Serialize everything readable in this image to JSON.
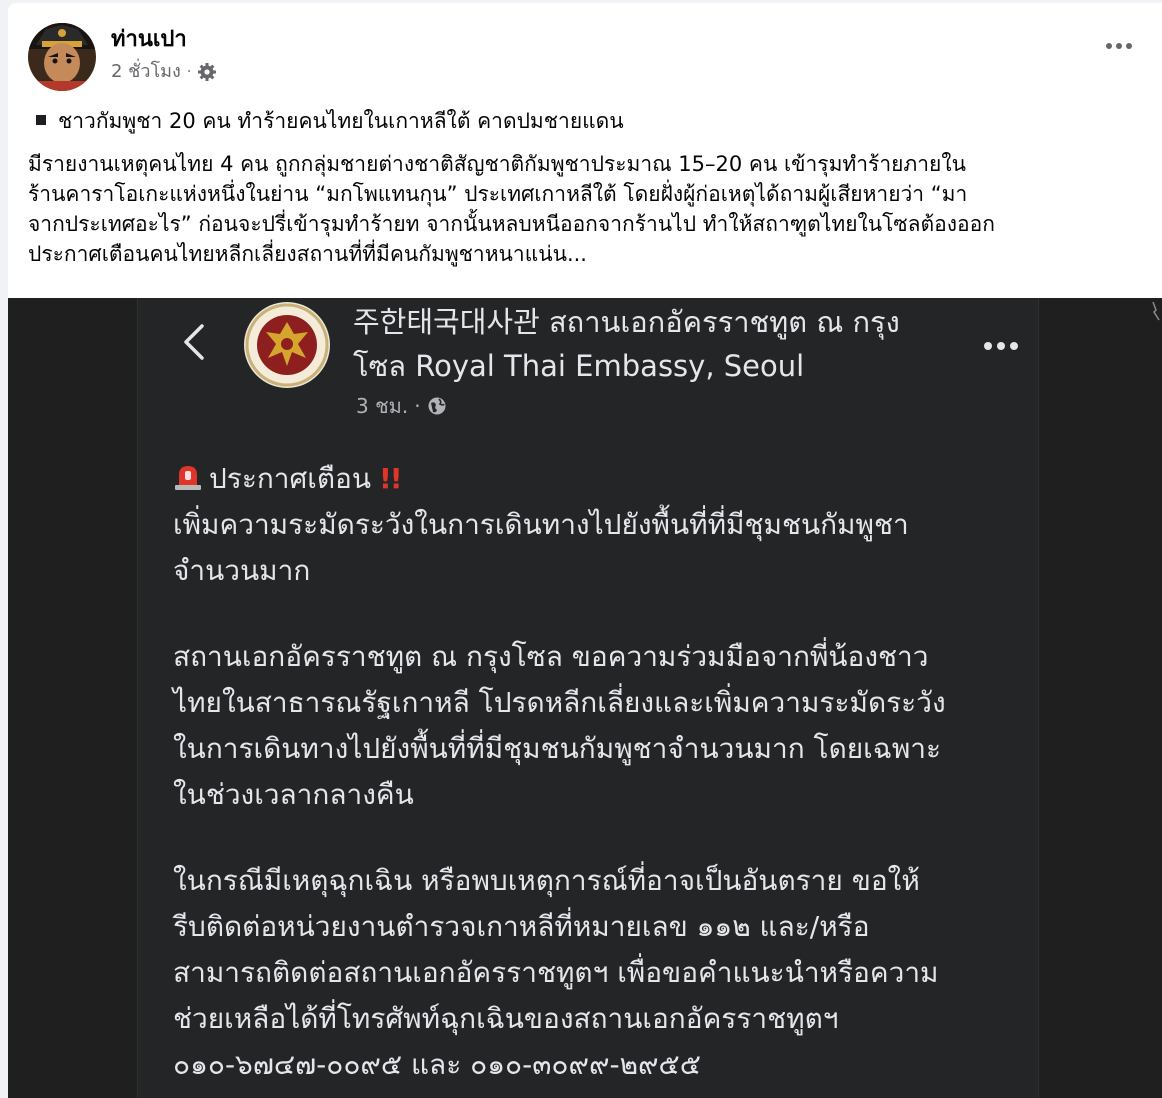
{
  "post": {
    "author": "ท่านเปา",
    "time": "2 ชั่วโมง",
    "separator": "·",
    "headline": "ชาวกัมพูชา 20 คน ทำร้ายคนไทยในเกาหลีใต้ คาดปมชายแดน",
    "body_lines": [
      "มีรายงานเหตุคนไทย 4 คน ถูกกลุ่มชายต่างชาติสัญชาติกัมพูชาประมาณ 15–20 คน เข้ารุมทำร้ายภายใน",
      "ร้านคาราโอเกะแห่งหนึ่งในย่าน “มกโพแทนกุน” ประเทศเกาหลีใต้ โดยฝั่งผู้ก่อเหตุได้ถามผู้เสียหายว่า “มา",
      "จากประเทศอะไร” ก่อนจะปรี่เข้ารุมทำร้ายท จากนั้นหลบหนีออกจากร้านไป ทำให้สถาฑูตไทยในโซลต้องออก",
      "ประกาศเตือนคนไทยหลีกเลี่ยงสถานที่ที่มีคนกัมพูชาหนาแน่น..."
    ],
    "icons": {
      "avatar": "avatar",
      "audience": "gear-icon",
      "more": "more-options-icon"
    }
  },
  "embedded_screenshot": {
    "page_name_line1": "주한태국대사관 สถานเอกอัครราชทูต ณ กรุง",
    "page_name_line2": "โซล Royal Thai Embassy, Seoul",
    "time": "3 ชม.",
    "separator": "·",
    "alert_title": "ประกาศเตือน",
    "alert_marks": "!!",
    "paragraph1": [
      "เพิ่มความระมัดระวังในการเดินทางไปยังพื้นที่ที่มีชุมชนกัมพูชา",
      "จำนวนมาก"
    ],
    "paragraph2": [
      "สถานเอกอัครราชทูต ณ กรุงโซล ขอความร่วมมือจากพี่น้องชาว",
      "ไทยในสาธารณรัฐเกาหลี โปรดหลีกเลี่ยงและเพิ่มความระมัดระวัง",
      "ในการเดินทางไปยังพื้นที่ที่มีชุมชนกัมพูชาจำนวนมาก โดยเฉพาะ",
      "ในช่วงเวลากลางคืน"
    ],
    "paragraph3": [
      "ในกรณีมีเหตุฉุกเฉิน หรือพบเหตุการณ์ที่อาจเป็นอันตราย ขอให้",
      "รีบติดต่อหน่วยงานตำรวจเกาหลีที่หมายเลข ๑๑๒ และ/หรือ",
      "สามารถติดต่อสถานเอกอัครราชทูตฯ เพื่อขอคำแนะนำหรือความ",
      "ช่วยเหลือได้ที่โทรศัพท์ฉุกเฉินของสถานเอกอัครราชทูตฯ",
      "๐๑๐-๖๗๔๗-๐๐๙๕ และ ๐๑๐-๓๐๙๙-๒๙๕๕"
    ],
    "icons": {
      "back": "back-chevron-icon",
      "logo": "embassy-emblem",
      "audience": "globe-icon",
      "more": "more-options-icon",
      "alert": "siren-icon"
    }
  },
  "colors": {
    "page_bg": "#f0f2f5",
    "card_bg": "#ffffff",
    "text_primary": "#050505",
    "text_secondary": "#65676b",
    "dark_bg": "#242526",
    "dark_text": "#e4e6eb",
    "alert_red": "#e0352b"
  }
}
